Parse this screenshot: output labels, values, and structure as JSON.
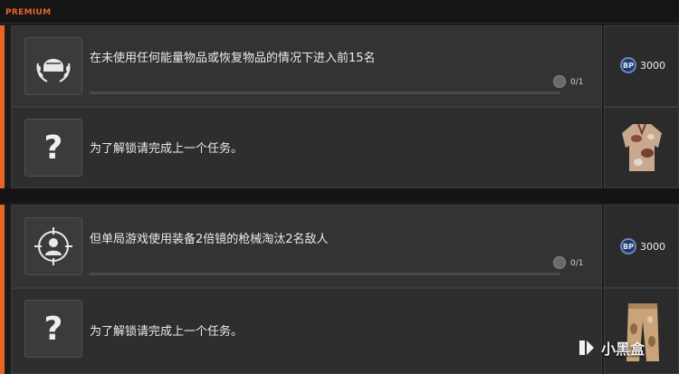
{
  "header": {
    "tier_label": "PREMIUM"
  },
  "missions": [
    {
      "task": "在未使用任何能量物品或恢复物品的情况下进入前15名",
      "progress_text": "0/1",
      "progress_fraction": 0,
      "reward_amount": "3000",
      "reward_icon": "bp-coin-icon",
      "icon": "helmet-wreath-icon"
    },
    {
      "task": "为了解锁请完成上一个任务。",
      "locked_symbol": "?",
      "reward_icon": "camo-jacket-icon"
    },
    {
      "task": "但单局游戏使用装备2倍镜的枪械淘汰2名敌人",
      "progress_text": "0/1",
      "progress_fraction": 0,
      "reward_amount": "3000",
      "reward_icon": "bp-coin-icon",
      "icon": "crosshair-person-icon"
    },
    {
      "task": "为了解锁请完成上一个任务。",
      "locked_symbol": "?",
      "reward_icon": "camo-pants-icon"
    }
  ],
  "watermark": {
    "text": "小黑盒"
  },
  "colors": {
    "accent": "#e8652a",
    "panel": "#333333",
    "bp_blue": "#1d3a6e"
  }
}
